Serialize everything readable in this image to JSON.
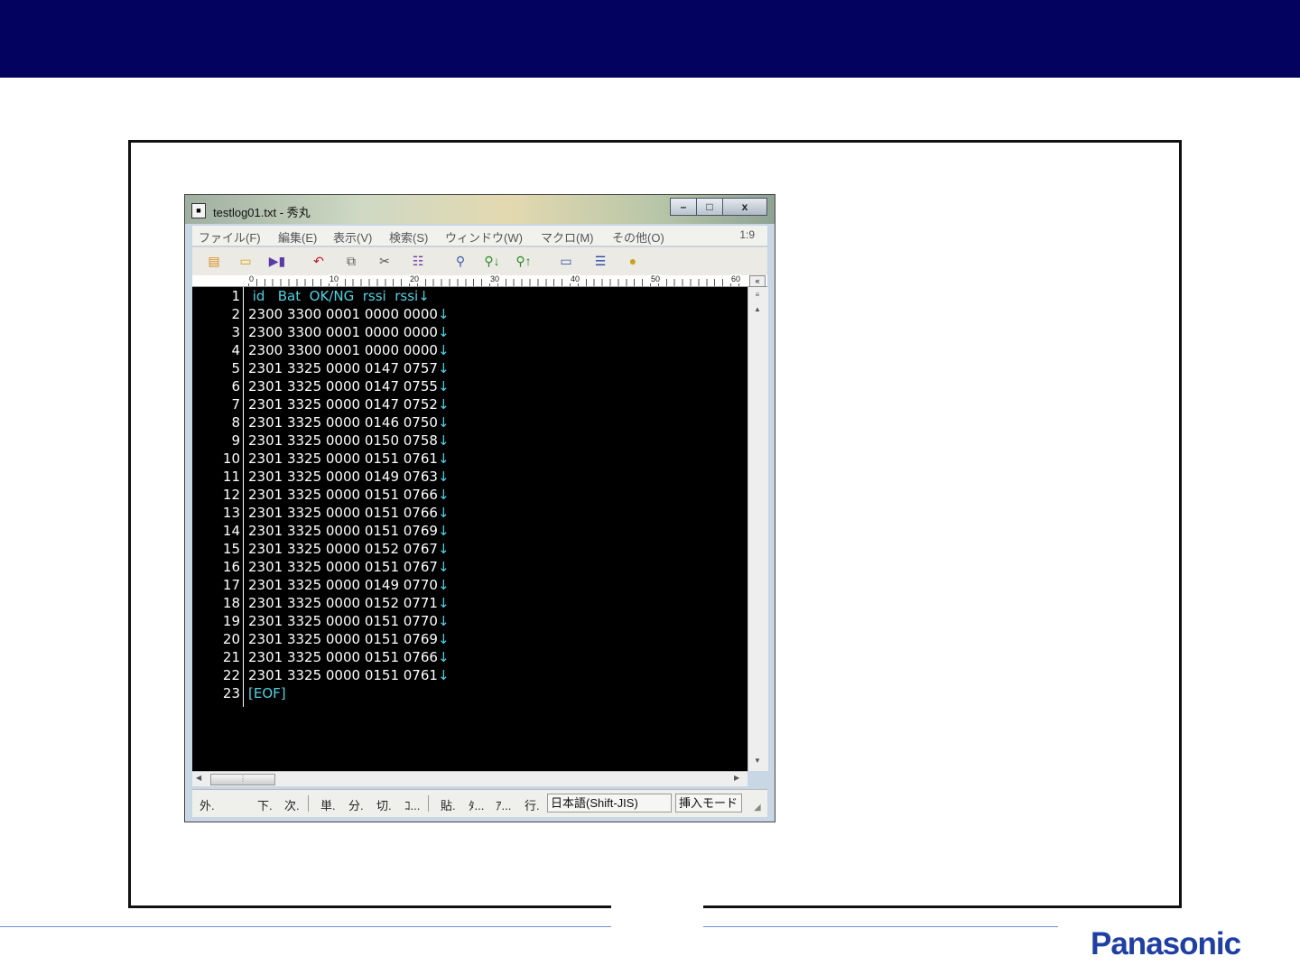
{
  "window": {
    "title": "testlog01.txt - 秀丸",
    "controls": {
      "minimize": "–",
      "maximize": "□",
      "close": "x"
    }
  },
  "menu": {
    "items": [
      "ファイル(F)",
      "編集(E)",
      "表示(V)",
      "検索(S)",
      "ウィンドウ(W)",
      "マクロ(M)",
      "その他(O)"
    ],
    "cursor_position": "1:9"
  },
  "toolbar": {
    "icons": [
      "new-file-icon",
      "open-folder-icon",
      "save-icon",
      "undo-icon",
      "copy-icon",
      "cut-icon",
      "paste-icon",
      "search-icon",
      "search-down-icon",
      "search-up-icon",
      "window-icon",
      "split-window-icon",
      "help-icon"
    ]
  },
  "ruler": {
    "labels": [
      "0",
      "10",
      "20",
      "30",
      "40",
      "50",
      "60"
    ],
    "collapse": "«"
  },
  "editor": {
    "lines": [
      {
        "num": "1",
        "text": " id   Bat  OK/NG  rssi  rssi",
        "type": "header"
      },
      {
        "num": "2",
        "text": "2300 3300 0001 0000 0000"
      },
      {
        "num": "3",
        "text": "2300 3300 0001 0000 0000"
      },
      {
        "num": "4",
        "text": "2300 3300 0001 0000 0000"
      },
      {
        "num": "5",
        "text": "2301 3325 0000 0147 0757"
      },
      {
        "num": "6",
        "text": "2301 3325 0000 0147 0755"
      },
      {
        "num": "7",
        "text": "2301 3325 0000 0147 0752"
      },
      {
        "num": "8",
        "text": "2301 3325 0000 0146 0750"
      },
      {
        "num": "9",
        "text": "2301 3325 0000 0150 0758"
      },
      {
        "num": "10",
        "text": "2301 3325 0000 0151 0761"
      },
      {
        "num": "11",
        "text": "2301 3325 0000 0149 0763"
      },
      {
        "num": "12",
        "text": "2301 3325 0000 0151 0766"
      },
      {
        "num": "13",
        "text": "2301 3325 0000 0151 0766"
      },
      {
        "num": "14",
        "text": "2301 3325 0000 0151 0769"
      },
      {
        "num": "15",
        "text": "2301 3325 0000 0152 0767"
      },
      {
        "num": "16",
        "text": "2301 3325 0000 0151 0767"
      },
      {
        "num": "17",
        "text": "2301 3325 0000 0149 0770"
      },
      {
        "num": "18",
        "text": "2301 3325 0000 0152 0771"
      },
      {
        "num": "19",
        "text": "2301 3325 0000 0151 0770"
      },
      {
        "num": "20",
        "text": "2301 3325 0000 0151 0769"
      },
      {
        "num": "21",
        "text": "2301 3325 0000 0151 0766"
      },
      {
        "num": "22",
        "text": "2301 3325 0000 0151 0761"
      },
      {
        "num": "23",
        "text": "[EOF]",
        "type": "eof"
      }
    ],
    "newline_mark": "↓"
  },
  "statusbar": {
    "items": [
      "外.",
      "下.",
      "次.",
      "単.",
      "分.",
      "切.",
      "ｺ...",
      "貼.",
      "ﾀ...",
      "ｱ...",
      "行."
    ],
    "encoding": "日本語(Shift-JIS)",
    "mode": "挿入モード"
  },
  "footer": {
    "brand": "Panasonic"
  },
  "colors": {
    "header_bar": "#03035f",
    "editor_bg": "#000000",
    "accent_text": "#4fd3e6",
    "brand": "#1f3fa3"
  }
}
